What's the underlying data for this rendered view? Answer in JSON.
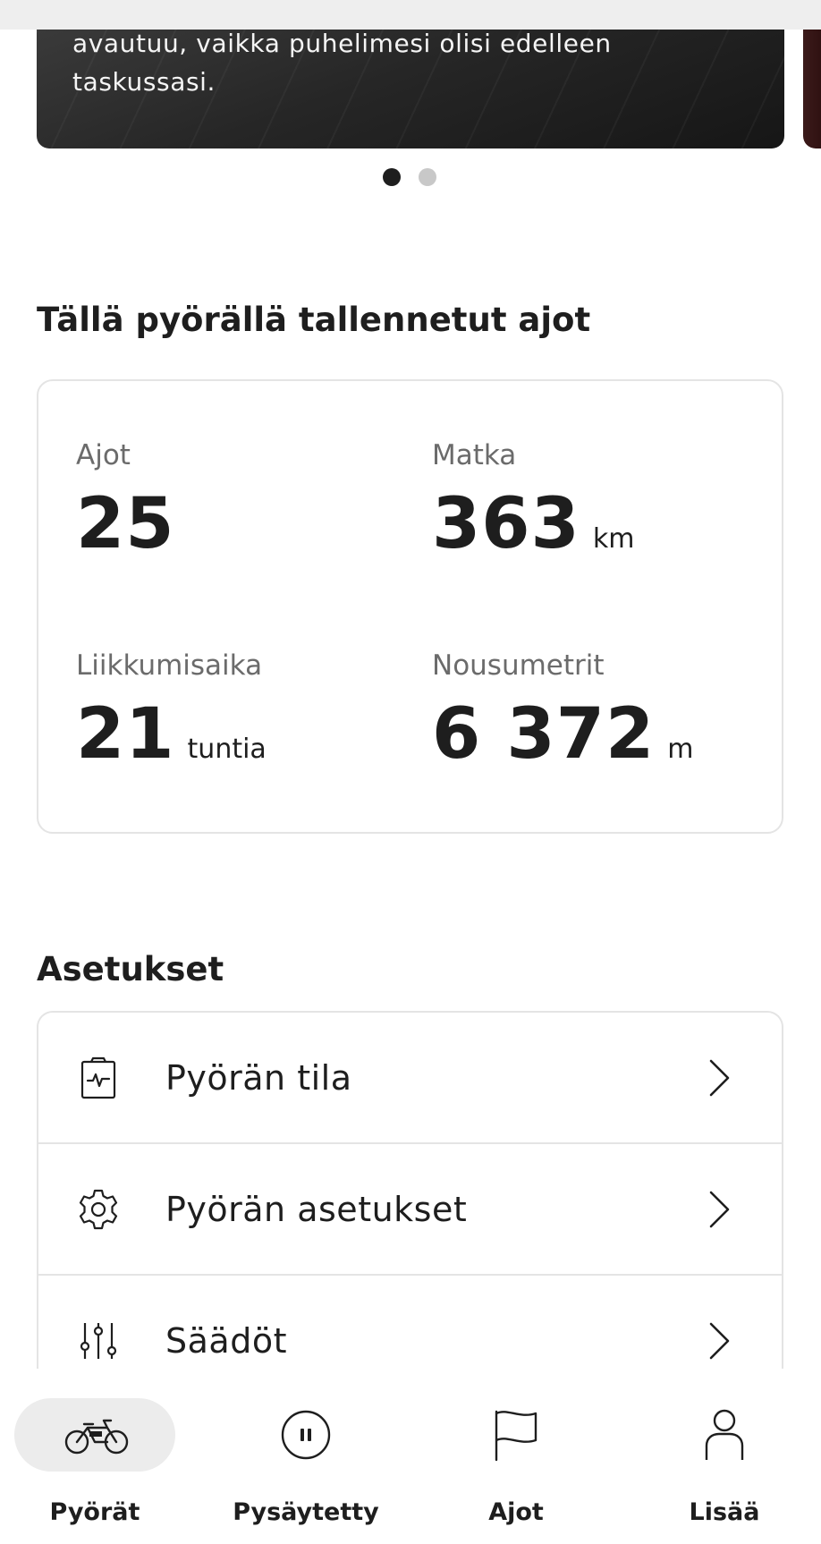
{
  "carousel": {
    "text_line1": "avautuu, vaikka puhelimesi olisi edelleen",
    "text_line2": "taskussasi.",
    "page_count": 2,
    "active_page": 1
  },
  "rides_section": {
    "title": "Tällä pyörällä tallennetut ajot",
    "stats": [
      {
        "label": "Ajot",
        "value": "25",
        "unit": ""
      },
      {
        "label": "Matka",
        "value": "363",
        "unit": "km"
      },
      {
        "label": "Liikkumisaika",
        "value": "21",
        "unit": "tuntia"
      },
      {
        "label": "Nousumetrit",
        "value": "6 372",
        "unit": "m"
      }
    ]
  },
  "settings_section": {
    "title": "Asetukset",
    "items": [
      {
        "label": "Pyörän tila",
        "icon": "clipboard-health-icon"
      },
      {
        "label": "Pyörän asetukset",
        "icon": "gear-icon"
      },
      {
        "label": "Säädöt",
        "icon": "sliders-icon"
      }
    ]
  },
  "bottom_nav": {
    "items": [
      {
        "label": "Pyörät",
        "icon": "bike-icon",
        "active": true
      },
      {
        "label": "Pysäytetty",
        "icon": "pause-circle-icon",
        "active": false
      },
      {
        "label": "Ajot",
        "icon": "flag-icon",
        "active": false
      },
      {
        "label": "Lisää",
        "icon": "person-icon",
        "active": false
      }
    ]
  },
  "colors": {
    "text": "#1e1e1e",
    "muted": "#6b6b6b",
    "border": "#e4e4e4",
    "active_pill": "#ececec"
  }
}
